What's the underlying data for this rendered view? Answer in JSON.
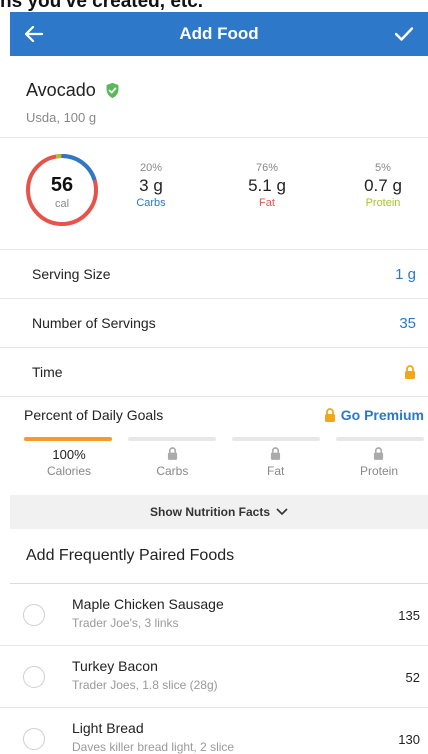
{
  "status_strip": {
    "text": "ns you've created, etc."
  },
  "header": {
    "title": "Add Food",
    "back_icon": "arrow-left-icon",
    "confirm_icon": "checkmark-icon",
    "bg": "#2d78c8"
  },
  "food": {
    "name": "Avocado",
    "source": "Usda, 100 g",
    "verified_icon": "verified-badge-icon"
  },
  "nutrition": {
    "calories": "56",
    "cal_unit": "cal",
    "macros": [
      {
        "pct": "20%",
        "amount": "3 g",
        "label": "Carbs",
        "color": "#2d78c8"
      },
      {
        "pct": "76%",
        "amount": "5.1 g",
        "label": "Fat",
        "color": "#e5534b"
      },
      {
        "pct": "5%",
        "amount": "0.7 g",
        "label": "Protein",
        "color": "#a6c62e"
      }
    ]
  },
  "details": {
    "serving_size_label": "Serving Size",
    "serving_size_value": "1 g",
    "servings_label": "Number of Servings",
    "servings_value": "35",
    "time_label": "Time",
    "lock_icon": "lock-icon"
  },
  "goals": {
    "title": "Percent of Daily Goals",
    "premium_label": "Go Premium",
    "items": [
      {
        "value": "100%",
        "label": "Calories",
        "progress": 1.0,
        "locked": false
      },
      {
        "value": "",
        "label": "Carbs",
        "progress": 0,
        "locked": true
      },
      {
        "value": "",
        "label": "Fat",
        "progress": 0,
        "locked": true
      },
      {
        "value": "",
        "label": "Protein",
        "progress": 0,
        "locked": true
      }
    ],
    "accent": "#f39c2d"
  },
  "show_facts_label": "Show Nutrition Facts",
  "paired": {
    "title": "Add Frequently Paired Foods",
    "items": [
      {
        "name": "Maple Chicken Sausage",
        "detail": "Trader Joe's, 3 links",
        "calories": "135"
      },
      {
        "name": "Turkey Bacon",
        "detail": "Trader Joes, 1.8 slice (28g)",
        "calories": "52"
      },
      {
        "name": "Light Bread",
        "detail": "Daves killer bread light, 2 slice",
        "calories": "130"
      }
    ]
  }
}
